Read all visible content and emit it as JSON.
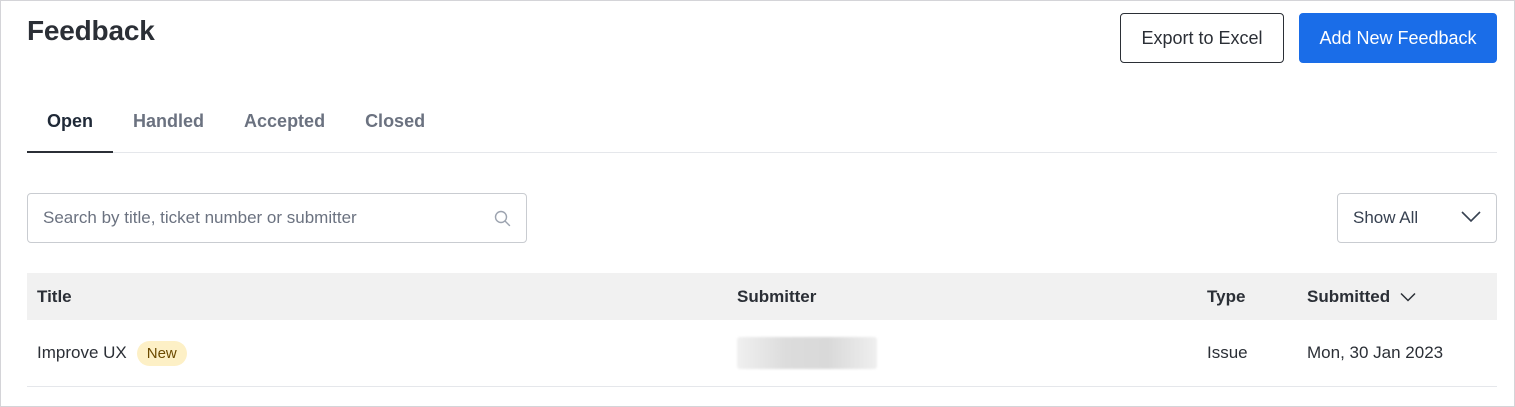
{
  "page": {
    "title": "Feedback"
  },
  "actions": {
    "export_label": "Export to Excel",
    "add_label": "Add New Feedback"
  },
  "tabs": [
    {
      "label": "Open",
      "active": true
    },
    {
      "label": "Handled",
      "active": false
    },
    {
      "label": "Accepted",
      "active": false
    },
    {
      "label": "Closed",
      "active": false
    }
  ],
  "search": {
    "placeholder": "Search by title, ticket number or submitter",
    "value": "",
    "icon": "search-icon"
  },
  "filter": {
    "selected": "Show All",
    "icon": "chevron-down-icon"
  },
  "table": {
    "headers": {
      "title": "Title",
      "submitter": "Submitter",
      "type": "Type",
      "submitted": "Submitted"
    },
    "sort": {
      "column": "submitted",
      "icon": "chevron-down-icon"
    },
    "rows": [
      {
        "title": "Improve UX",
        "badge": "New",
        "submitter": "",
        "type": "Issue",
        "submitted": "Mon, 30 Jan 2023"
      }
    ]
  },
  "colors": {
    "accent": "#1a6de8",
    "badge_bg": "#fdf0c6",
    "header_bg": "#f1f1f1"
  }
}
